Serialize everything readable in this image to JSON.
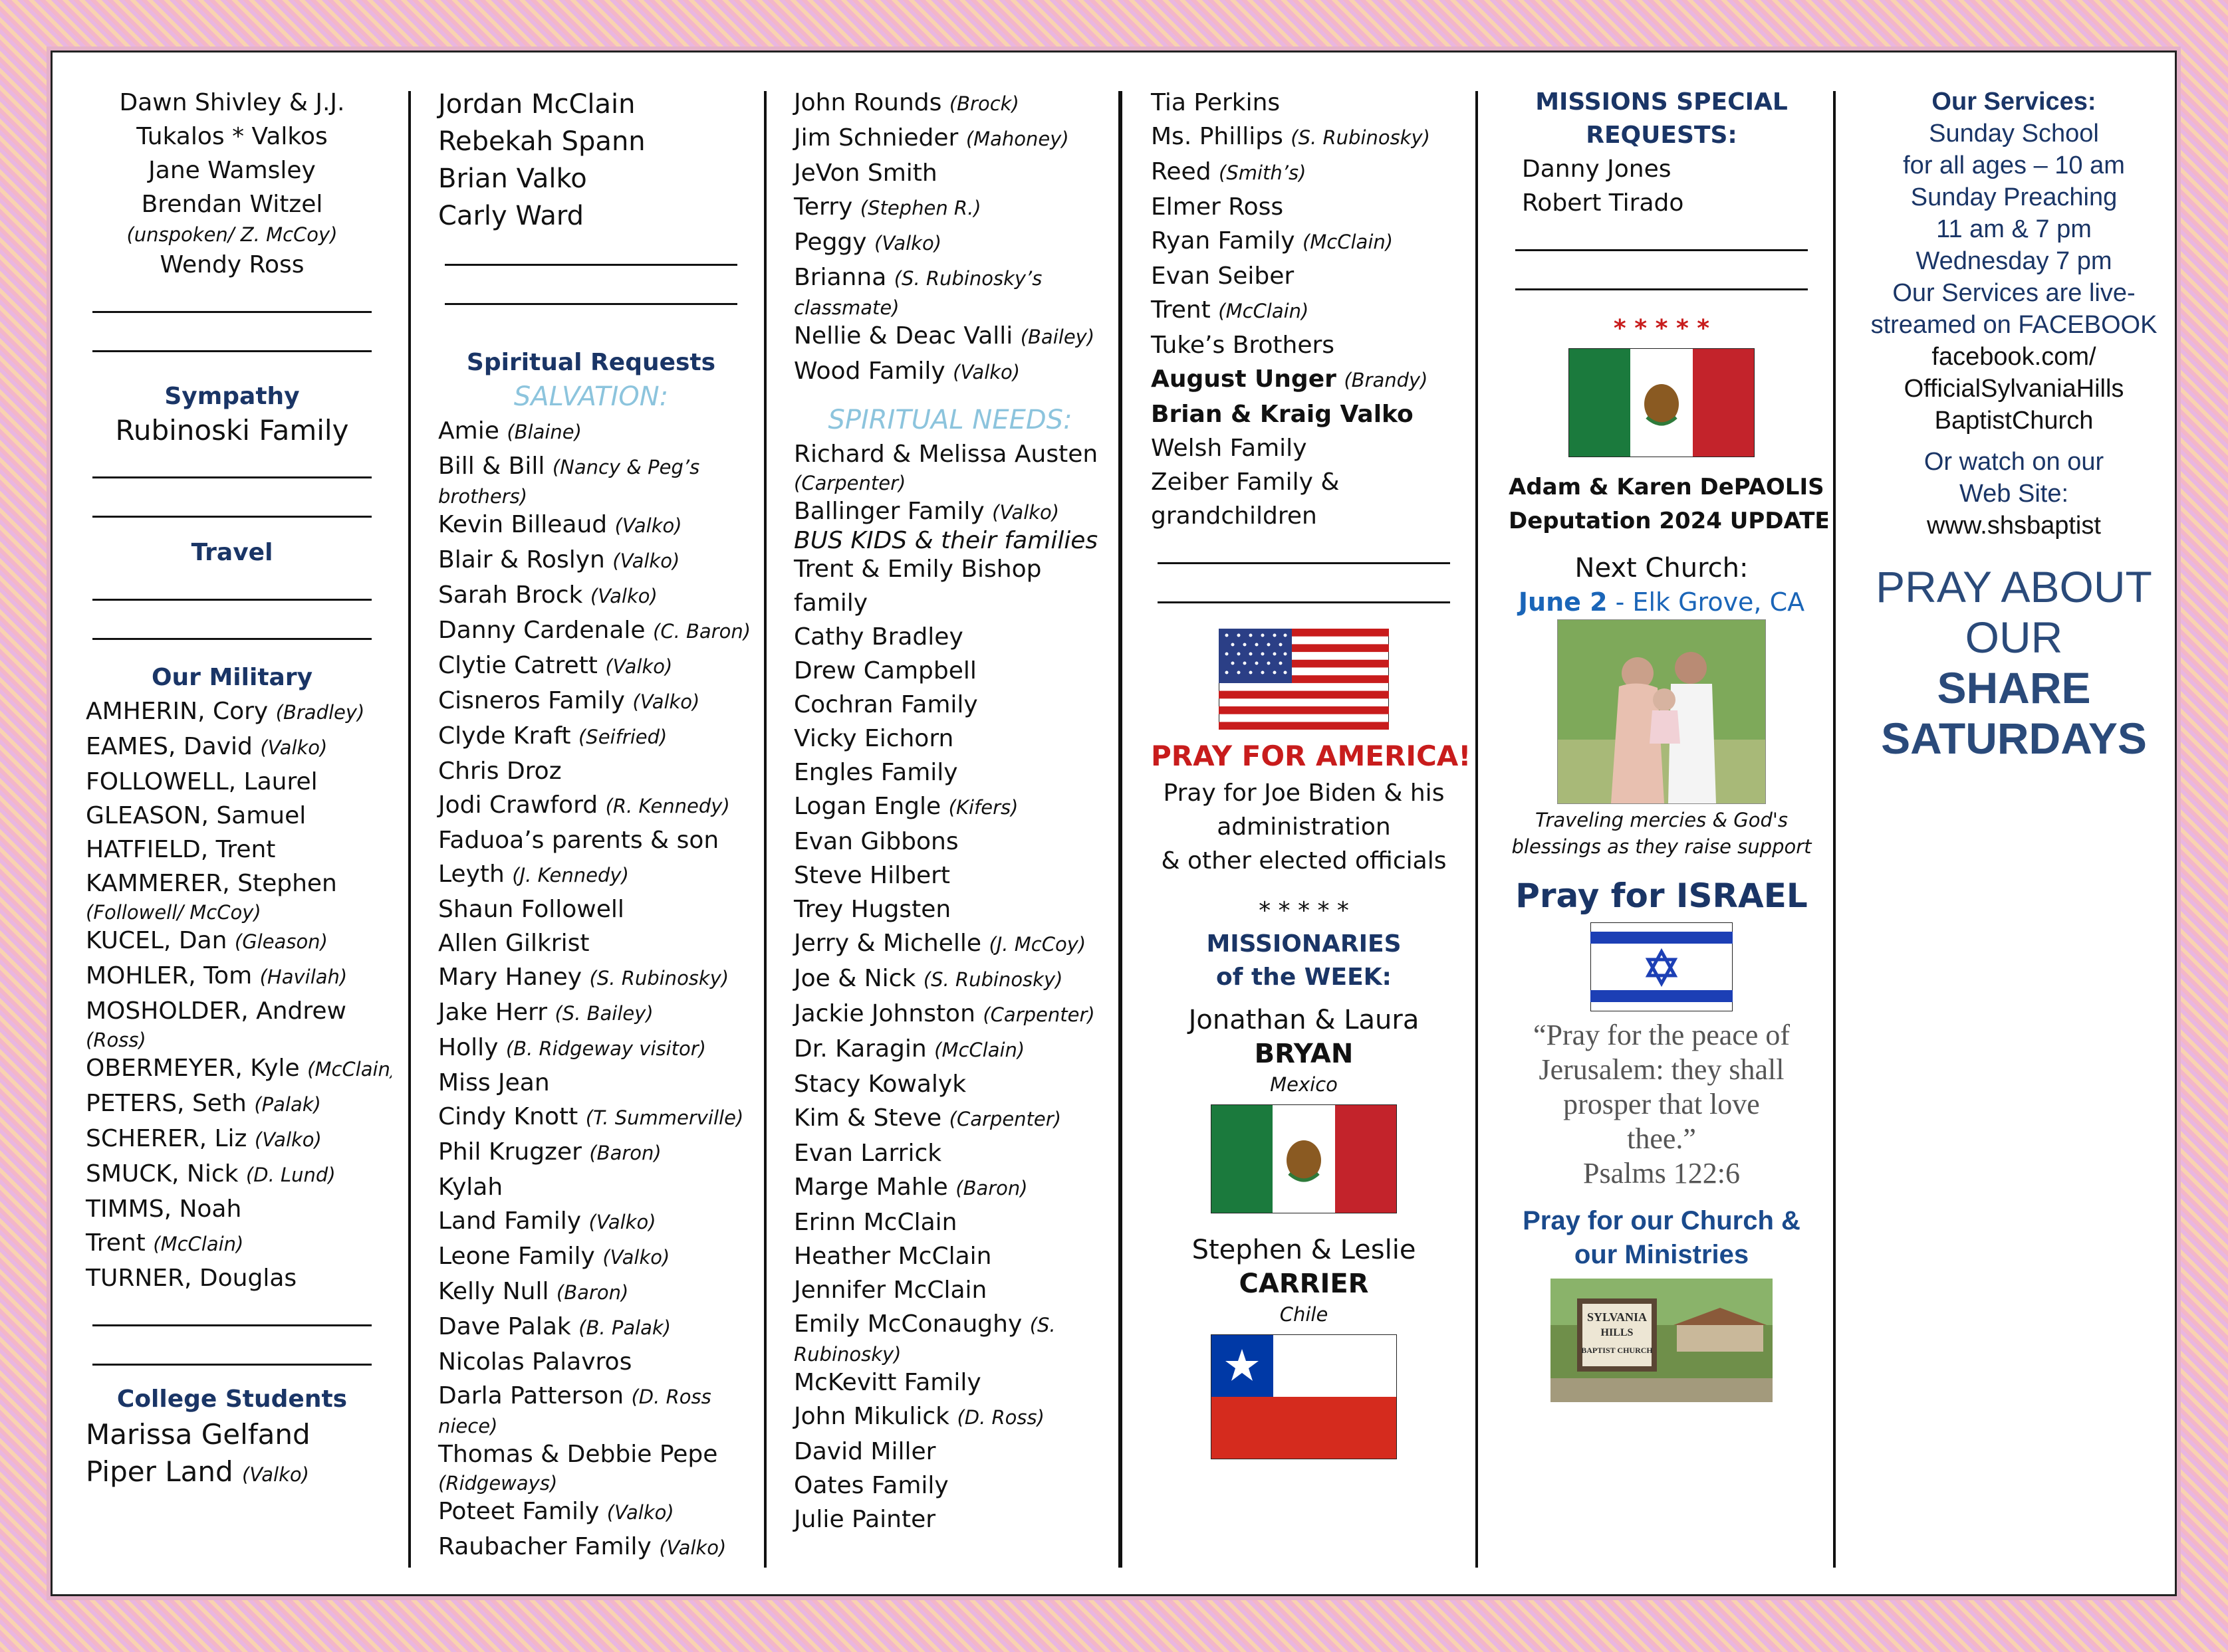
{
  "col1": {
    "top": [
      "Dawn Shivley & J.J.",
      "Tukalos * Valkos",
      "Jane Wamsley",
      "Brendan Witzel"
    ],
    "top_note": "(unspoken/ Z. McCoy)",
    "top_last": "Wendy Ross",
    "sympathy_head": "Sympathy",
    "sympathy_name": "Rubinoski Family",
    "travel_head": "Travel",
    "military_head": "Our Military",
    "military": [
      {
        "n": "AMHERIN, Cory",
        "p": "(Bradley)"
      },
      {
        "n": "EAMES, David",
        "p": "(Valko)"
      },
      {
        "n": "FOLLOWELL, Laurel",
        "p": ""
      },
      {
        "n": "GLEASON, Samuel",
        "p": ""
      },
      {
        "n": "HATFIELD, Trent",
        "p": ""
      },
      {
        "n": "KAMMERER, Stephen",
        "p": ""
      },
      {
        "n": "",
        "p": "(Followell/ McCoy)"
      },
      {
        "n": "KUCEL, Dan",
        "p": "(Gleason)"
      },
      {
        "n": "MOHLER, Tom",
        "p": "(Havilah)"
      },
      {
        "n": "MOSHOLDER, Andrew",
        "p": ""
      },
      {
        "n": "",
        "p": "(Ross)"
      },
      {
        "n": "OBERMEYER, Kyle",
        "p": "(McClain)"
      },
      {
        "n": "PETERS, Seth",
        "p": "(Palak)"
      },
      {
        "n": "SCHERER, Liz",
        "p": "(Valko)"
      },
      {
        "n": "SMUCK, Nick",
        "p": "(D. Lund)"
      },
      {
        "n": "TIMMS, Noah",
        "p": ""
      },
      {
        "n": "Trent",
        "p": "(McClain)"
      },
      {
        "n": "TURNER, Douglas",
        "p": ""
      }
    ],
    "college_head": "College Students",
    "college": [
      {
        "n": "Marissa Gelfand",
        "p": ""
      },
      {
        "n": "Piper Land",
        "p": "(Valko)"
      }
    ]
  },
  "col2": {
    "top": [
      "Jordan McClain",
      "Rebekah Spann",
      "Brian Valko",
      "Carly Ward"
    ],
    "head": "Spiritual Requests",
    "sub": "SALVATION:",
    "items": [
      {
        "n": "Amie",
        "p": "(Blaine)"
      },
      {
        "n": "Bill & Bill",
        "p": "(Nancy & Peg’s"
      },
      {
        "n": "",
        "p": "brothers)"
      },
      {
        "n": "Kevin Billeaud",
        "p": "(Valko)"
      },
      {
        "n": "Blair & Roslyn",
        "p": "(Valko)"
      },
      {
        "n": "Sarah Brock",
        "p": "(Valko)"
      },
      {
        "n": "Danny Cardenale",
        "p": "(C. Baron)"
      },
      {
        "n": "Clytie Catrett",
        "p": "(Valko)"
      },
      {
        "n": "Cisneros Family",
        "p": "(Valko)"
      },
      {
        "n": "Clyde Kraft",
        "p": "(Seifried)"
      },
      {
        "n": "Chris Droz",
        "p": ""
      },
      {
        "n": "Jodi Crawford",
        "p": "(R. Kennedy)"
      },
      {
        "n": "Faduoa’s parents & son",
        "p": ""
      },
      {
        "n": "Leyth",
        "p": "(J. Kennedy)"
      },
      {
        "n": "Shaun Followell",
        "p": ""
      },
      {
        "n": "Allen Gilkrist",
        "p": ""
      },
      {
        "n": "Mary Haney",
        "p": "(S. Rubinosky)"
      },
      {
        "n": "Jake Herr",
        "p": "(S. Bailey)"
      },
      {
        "n": "Holly",
        "p": "(B. Ridgeway visitor)"
      },
      {
        "n": "Miss Jean",
        "p": ""
      },
      {
        "n": "Cindy Knott",
        "p": "(T. Summerville)"
      },
      {
        "n": "Phil Krugzer",
        "p": "(Baron)"
      },
      {
        "n": "Kylah",
        "p": ""
      },
      {
        "n": "Land Family",
        "p": "(Valko)"
      },
      {
        "n": "Leone Family",
        "p": "(Valko)"
      },
      {
        "n": "Kelly Null",
        "p": "(Baron)"
      },
      {
        "n": "Dave Palak",
        "p": "(B. Palak)"
      },
      {
        "n": "Nicolas Palavros",
        "p": ""
      },
      {
        "n": "Darla Patterson",
        "p": "(D. Ross"
      },
      {
        "n": "",
        "p": "niece)"
      },
      {
        "n": "Thomas & Debbie Pepe",
        "p": ""
      },
      {
        "n": "",
        "p": "(Ridgeways)"
      },
      {
        "n": "Poteet Family",
        "p": "(Valko)"
      },
      {
        "n": "Raubacher Family",
        "p": "(Valko)"
      }
    ]
  },
  "col3": {
    "top": [
      {
        "n": "John Rounds",
        "p": "(Brock)"
      },
      {
        "n": "Jim Schnieder",
        "p": "(Mahoney)"
      },
      {
        "n": "JeVon Smith",
        "p": ""
      },
      {
        "n": "Terry",
        "p": "(Stephen R.)"
      },
      {
        "n": "Peggy",
        "p": "(Valko)"
      },
      {
        "n": "Brianna",
        "p": "(S. Rubinosky’s"
      },
      {
        "n": "",
        "p": "classmate)"
      },
      {
        "n": "Nellie & Deac Valli",
        "p": "(Bailey)"
      },
      {
        "n": "Wood Family",
        "p": "(Valko)"
      }
    ],
    "sub": "SPIRITUAL NEEDS:",
    "items": [
      {
        "n": "Richard & Melissa Austen",
        "p": ""
      },
      {
        "n": "",
        "p": "(Carpenter)"
      },
      {
        "n": "Ballinger Family",
        "p": "(Valko)"
      },
      {
        "n": "",
        "p": "BUS KIDS & their families"
      },
      {
        "n": "Trent & Emily Bishop",
        "p": ""
      },
      {
        "n": "family",
        "p": ""
      },
      {
        "n": "Cathy Bradley",
        "p": ""
      },
      {
        "n": "Drew Campbell",
        "p": ""
      },
      {
        "n": "Cochran Family",
        "p": ""
      },
      {
        "n": "Vicky Eichorn",
        "p": ""
      },
      {
        "n": "Engles Family",
        "p": ""
      },
      {
        "n": "Logan Engle",
        "p": "(Kifers)"
      },
      {
        "n": "Evan Gibbons",
        "p": ""
      },
      {
        "n": "Steve Hilbert",
        "p": ""
      },
      {
        "n": "Trey Hugsten",
        "p": ""
      },
      {
        "n": "Jerry & Michelle",
        "p": "(J. McCoy)"
      },
      {
        "n": "Joe & Nick",
        "p": "(S. Rubinosky)"
      },
      {
        "n": "Jackie Johnston",
        "p": "(Carpenter)"
      },
      {
        "n": "Dr. Karagin",
        "p": "(McClain)"
      },
      {
        "n": "Stacy Kowalyk",
        "p": ""
      },
      {
        "n": "Kim & Steve",
        "p": "(Carpenter)"
      },
      {
        "n": "Evan Larrick",
        "p": ""
      },
      {
        "n": "Marge Mahle",
        "p": "(Baron)"
      },
      {
        "n": "Erinn McClain",
        "p": ""
      },
      {
        "n": "Heather McClain",
        "p": ""
      },
      {
        "n": "Jennifer McClain",
        "p": ""
      },
      {
        "n": "Emily McConaughy",
        "p": "(S."
      },
      {
        "n": "",
        "p": "Rubinosky)"
      },
      {
        "n": "McKevitt Family",
        "p": ""
      },
      {
        "n": "John Mikulick",
        "p": "(D. Ross)"
      },
      {
        "n": "David Miller",
        "p": ""
      },
      {
        "n": "Oates Family",
        "p": ""
      },
      {
        "n": "Julie Painter",
        "p": ""
      }
    ]
  },
  "col4": {
    "items": [
      {
        "n": "Tia Perkins",
        "p": "",
        "b": false
      },
      {
        "n": "Ms. Phillips",
        "p": "(S. Rubinosky)",
        "b": false
      },
      {
        "n": "Reed",
        "p": "(Smith’s)",
        "b": false
      },
      {
        "n": "Elmer Ross",
        "p": "",
        "b": false
      },
      {
        "n": "Ryan Family",
        "p": "(McClain)",
        "b": false
      },
      {
        "n": "Evan Seiber",
        "p": "",
        "b": false
      },
      {
        "n": "Trent",
        "p": "(McClain)",
        "b": false
      },
      {
        "n": "Tuke’s Brothers",
        "p": "",
        "b": false
      },
      {
        "n": "August Unger",
        "p": "(Brandy)",
        "b": true
      },
      {
        "n": "Brian & Kraig Valko",
        "p": "",
        "b": true
      },
      {
        "n": "Welsh Family",
        "p": "",
        "b": false
      },
      {
        "n": "Zeiber Family &",
        "p": "",
        "b": false
      },
      {
        "n": "grandchildren",
        "p": "",
        "b": false
      }
    ],
    "pray_america": "PRAY FOR AMERICA!",
    "pray_lines": [
      "Pray for Joe Biden & his",
      "administration",
      "& other elected officials"
    ],
    "stars": "* * * * *",
    "missionaries_head": [
      "MISSIONARIES",
      "of the WEEK:"
    ],
    "m1_names": "Jonathan & Laura",
    "m1_last": "BRYAN",
    "m1_country": "Mexico",
    "m2_names": "Stephen & Leslie",
    "m2_last": "CARRIER",
    "m2_country": "Chile"
  },
  "col5": {
    "head": [
      "MISSIONS SPECIAL",
      "REQUESTS:"
    ],
    "items": [
      "Danny Jones",
      "Robert Tirado"
    ],
    "stars": "* * * * *",
    "depaolis": [
      "Adam & Karen DePAOLIS",
      "Deputation 2024 UPDATE"
    ],
    "next_church": "Next Church:",
    "date": "June 2",
    "place": " - Elk Grove, CA",
    "caption": [
      "Traveling mercies & God's",
      "blessings as they raise support"
    ],
    "israel_head": "Pray for ISRAEL",
    "verse": [
      "“Pray for the peace of",
      "Jerusalem: they shall",
      "prosper that love",
      "thee.”",
      "Psalms 122:6"
    ],
    "church_head": [
      "Pray for our Church &",
      "our Ministries"
    ],
    "sign_text": [
      "SYLVANIA",
      "HILLS",
      "BAPTIST CHURCH"
    ]
  },
  "col6": {
    "services_head": "Our Services:",
    "services": [
      "Sunday School",
      "for all ages – 10 am",
      "Sunday Preaching",
      "11 am & 7 pm",
      "Wednesday 7 pm",
      "Our Services are live-",
      "streamed on FACEBOOK",
      "facebook.com/",
      "OfficialSylvaniaHills",
      "BaptistChurch"
    ],
    "watch": [
      "Or watch on our",
      "Web Site:",
      "www.shsbaptist"
    ],
    "pray": [
      "PRAY ABOUT",
      "OUR",
      "SHARE",
      "SATURDAYS"
    ]
  },
  "colors": {
    "heading": "#1a3566",
    "accent_red": "#c81c1c",
    "light_blue": "#8cc4dd",
    "link_blue": "#1a65b8"
  }
}
